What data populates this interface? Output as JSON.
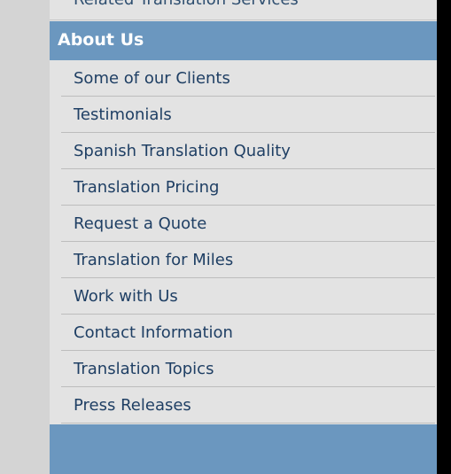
{
  "menu": {
    "previous_item_cutoff": "Related Translation Services",
    "section_title": "About Us",
    "items": [
      {
        "label": "Some of our Clients"
      },
      {
        "label": "Testimonials"
      },
      {
        "label": "Spanish Translation Quality"
      },
      {
        "label": "Translation Pricing"
      },
      {
        "label": "Request a Quote"
      },
      {
        "label": "Translation for Miles"
      },
      {
        "label": "Work with Us"
      },
      {
        "label": "Contact Information"
      },
      {
        "label": "Translation Topics"
      },
      {
        "label": "Press Releases"
      }
    ]
  },
  "colors": {
    "header_blue": "#6b97bf",
    "menu_bg": "#e3e3e3",
    "left_strip": "#d4d4d4",
    "page_bg": "#000000",
    "link_text": "#1f3f64"
  }
}
